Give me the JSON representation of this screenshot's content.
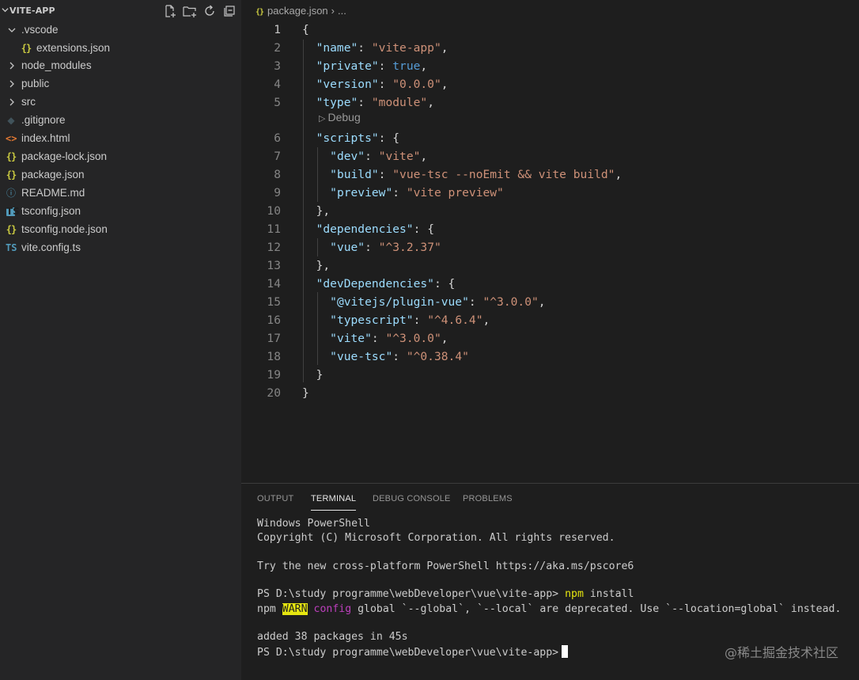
{
  "explorer": {
    "title": "VITE-APP",
    "actions": [
      "new-file-icon",
      "new-folder-icon",
      "refresh-icon",
      "collapse-all-icon"
    ],
    "items": [
      {
        "label": ".vscode",
        "type": "folder",
        "expanded": true
      },
      {
        "label": "extensions.json",
        "type": "json"
      },
      {
        "label": "node_modules",
        "type": "folder",
        "expanded": false
      },
      {
        "label": "public",
        "type": "folder",
        "expanded": false
      },
      {
        "label": "src",
        "type": "folder",
        "expanded": false
      },
      {
        "label": ".gitignore",
        "type": "git"
      },
      {
        "label": "index.html",
        "type": "html"
      },
      {
        "label": "package-lock.json",
        "type": "json"
      },
      {
        "label": "package.json",
        "type": "json"
      },
      {
        "label": "README.md",
        "type": "info"
      },
      {
        "label": "tsconfig.json",
        "type": "tsconfig"
      },
      {
        "label": "tsconfig.node.json",
        "type": "json"
      },
      {
        "label": "vite.config.ts",
        "type": "ts"
      }
    ]
  },
  "editor": {
    "breadcrumb": {
      "icon": "{}",
      "file": "package.json",
      "sep": "›",
      "more": "..."
    },
    "codelens": {
      "icon": "▷",
      "label": "Debug"
    },
    "active_line": 1,
    "lines": [
      {
        "n": "1",
        "text": "{"
      },
      {
        "n": "2",
        "text": "  \"name\": \"vite-app\","
      },
      {
        "n": "3",
        "text": "  \"private\": true,"
      },
      {
        "n": "4",
        "text": "  \"version\": \"0.0.0\","
      },
      {
        "n": "5",
        "text": "  \"type\": \"module\","
      },
      {
        "n": "6",
        "text": "  \"scripts\": {"
      },
      {
        "n": "7",
        "text": "    \"dev\": \"vite\","
      },
      {
        "n": "8",
        "text": "    \"build\": \"vue-tsc --noEmit && vite build\","
      },
      {
        "n": "9",
        "text": "    \"preview\": \"vite preview\""
      },
      {
        "n": "10",
        "text": "  },"
      },
      {
        "n": "11",
        "text": "  \"dependencies\": {"
      },
      {
        "n": "12",
        "text": "    \"vue\": \"^3.2.37\""
      },
      {
        "n": "13",
        "text": "  },"
      },
      {
        "n": "14",
        "text": "  \"devDependencies\": {"
      },
      {
        "n": "15",
        "text": "    \"@vitejs/plugin-vue\": \"^3.0.0\","
      },
      {
        "n": "16",
        "text": "    \"typescript\": \"^4.6.4\","
      },
      {
        "n": "17",
        "text": "    \"vite\": \"^3.0.0\","
      },
      {
        "n": "18",
        "text": "    \"vue-tsc\": \"^0.38.4\""
      },
      {
        "n": "19",
        "text": "  }"
      },
      {
        "n": "20",
        "text": "}"
      }
    ]
  },
  "panel": {
    "tabs": [
      {
        "label": "OUTPUT",
        "active": false
      },
      {
        "label": "TERMINAL",
        "active": true
      },
      {
        "label": "DEBUG CONSOLE",
        "active": false
      },
      {
        "label": "PROBLEMS",
        "active": false
      }
    ],
    "terminal": {
      "line1": "Windows PowerShell",
      "line2": "Copyright (C) Microsoft Corporation. All rights reserved.",
      "line3": "Try the new cross-platform PowerShell https://aka.ms/pscore6",
      "prompt": "PS D:\\study programme\\webDeveloper\\vue\\vite-app>",
      "cmd_npm": "npm",
      "cmd_rest": "install",
      "warn_prefix": "npm",
      "warn_badge": "WARN",
      "warn_kind": "config",
      "warn_msg": "global `--global`, `--local` are deprecated. Use `--location=global` instead.",
      "added": "added 38 packages in 45s",
      "prompt2": "PS D:\\study programme\\webDeveloper\\vue\\vite-app>"
    }
  },
  "watermark": "@稀土掘金技术社区",
  "colors": {
    "sidebar_bg": "#252526",
    "editor_bg": "#1e1e1e",
    "json_key": "#9cdcfe",
    "json_string": "#ce9178",
    "json_bool": "#569cd6",
    "terminal_yellow": "#e5e510",
    "terminal_magenta": "#bc3fbc"
  }
}
